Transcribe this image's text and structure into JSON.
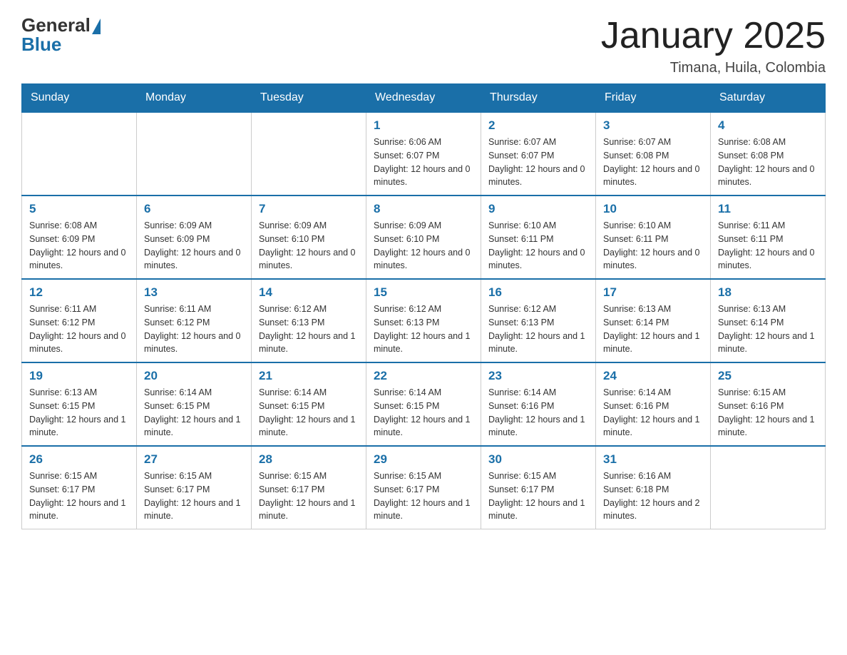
{
  "header": {
    "logo_general": "General",
    "logo_blue": "Blue",
    "title": "January 2025",
    "subtitle": "Timana, Huila, Colombia"
  },
  "weekdays": [
    "Sunday",
    "Monday",
    "Tuesday",
    "Wednesday",
    "Thursday",
    "Friday",
    "Saturday"
  ],
  "weeks": [
    [
      {
        "day": "",
        "sunrise": "",
        "sunset": "",
        "daylight": ""
      },
      {
        "day": "",
        "sunrise": "",
        "sunset": "",
        "daylight": ""
      },
      {
        "day": "",
        "sunrise": "",
        "sunset": "",
        "daylight": ""
      },
      {
        "day": "1",
        "sunrise": "Sunrise: 6:06 AM",
        "sunset": "Sunset: 6:07 PM",
        "daylight": "Daylight: 12 hours and 0 minutes."
      },
      {
        "day": "2",
        "sunrise": "Sunrise: 6:07 AM",
        "sunset": "Sunset: 6:07 PM",
        "daylight": "Daylight: 12 hours and 0 minutes."
      },
      {
        "day": "3",
        "sunrise": "Sunrise: 6:07 AM",
        "sunset": "Sunset: 6:08 PM",
        "daylight": "Daylight: 12 hours and 0 minutes."
      },
      {
        "day": "4",
        "sunrise": "Sunrise: 6:08 AM",
        "sunset": "Sunset: 6:08 PM",
        "daylight": "Daylight: 12 hours and 0 minutes."
      }
    ],
    [
      {
        "day": "5",
        "sunrise": "Sunrise: 6:08 AM",
        "sunset": "Sunset: 6:09 PM",
        "daylight": "Daylight: 12 hours and 0 minutes."
      },
      {
        "day": "6",
        "sunrise": "Sunrise: 6:09 AM",
        "sunset": "Sunset: 6:09 PM",
        "daylight": "Daylight: 12 hours and 0 minutes."
      },
      {
        "day": "7",
        "sunrise": "Sunrise: 6:09 AM",
        "sunset": "Sunset: 6:10 PM",
        "daylight": "Daylight: 12 hours and 0 minutes."
      },
      {
        "day": "8",
        "sunrise": "Sunrise: 6:09 AM",
        "sunset": "Sunset: 6:10 PM",
        "daylight": "Daylight: 12 hours and 0 minutes."
      },
      {
        "day": "9",
        "sunrise": "Sunrise: 6:10 AM",
        "sunset": "Sunset: 6:11 PM",
        "daylight": "Daylight: 12 hours and 0 minutes."
      },
      {
        "day": "10",
        "sunrise": "Sunrise: 6:10 AM",
        "sunset": "Sunset: 6:11 PM",
        "daylight": "Daylight: 12 hours and 0 minutes."
      },
      {
        "day": "11",
        "sunrise": "Sunrise: 6:11 AM",
        "sunset": "Sunset: 6:11 PM",
        "daylight": "Daylight: 12 hours and 0 minutes."
      }
    ],
    [
      {
        "day": "12",
        "sunrise": "Sunrise: 6:11 AM",
        "sunset": "Sunset: 6:12 PM",
        "daylight": "Daylight: 12 hours and 0 minutes."
      },
      {
        "day": "13",
        "sunrise": "Sunrise: 6:11 AM",
        "sunset": "Sunset: 6:12 PM",
        "daylight": "Daylight: 12 hours and 0 minutes."
      },
      {
        "day": "14",
        "sunrise": "Sunrise: 6:12 AM",
        "sunset": "Sunset: 6:13 PM",
        "daylight": "Daylight: 12 hours and 1 minute."
      },
      {
        "day": "15",
        "sunrise": "Sunrise: 6:12 AM",
        "sunset": "Sunset: 6:13 PM",
        "daylight": "Daylight: 12 hours and 1 minute."
      },
      {
        "day": "16",
        "sunrise": "Sunrise: 6:12 AM",
        "sunset": "Sunset: 6:13 PM",
        "daylight": "Daylight: 12 hours and 1 minute."
      },
      {
        "day": "17",
        "sunrise": "Sunrise: 6:13 AM",
        "sunset": "Sunset: 6:14 PM",
        "daylight": "Daylight: 12 hours and 1 minute."
      },
      {
        "day": "18",
        "sunrise": "Sunrise: 6:13 AM",
        "sunset": "Sunset: 6:14 PM",
        "daylight": "Daylight: 12 hours and 1 minute."
      }
    ],
    [
      {
        "day": "19",
        "sunrise": "Sunrise: 6:13 AM",
        "sunset": "Sunset: 6:15 PM",
        "daylight": "Daylight: 12 hours and 1 minute."
      },
      {
        "day": "20",
        "sunrise": "Sunrise: 6:14 AM",
        "sunset": "Sunset: 6:15 PM",
        "daylight": "Daylight: 12 hours and 1 minute."
      },
      {
        "day": "21",
        "sunrise": "Sunrise: 6:14 AM",
        "sunset": "Sunset: 6:15 PM",
        "daylight": "Daylight: 12 hours and 1 minute."
      },
      {
        "day": "22",
        "sunrise": "Sunrise: 6:14 AM",
        "sunset": "Sunset: 6:15 PM",
        "daylight": "Daylight: 12 hours and 1 minute."
      },
      {
        "day": "23",
        "sunrise": "Sunrise: 6:14 AM",
        "sunset": "Sunset: 6:16 PM",
        "daylight": "Daylight: 12 hours and 1 minute."
      },
      {
        "day": "24",
        "sunrise": "Sunrise: 6:14 AM",
        "sunset": "Sunset: 6:16 PM",
        "daylight": "Daylight: 12 hours and 1 minute."
      },
      {
        "day": "25",
        "sunrise": "Sunrise: 6:15 AM",
        "sunset": "Sunset: 6:16 PM",
        "daylight": "Daylight: 12 hours and 1 minute."
      }
    ],
    [
      {
        "day": "26",
        "sunrise": "Sunrise: 6:15 AM",
        "sunset": "Sunset: 6:17 PM",
        "daylight": "Daylight: 12 hours and 1 minute."
      },
      {
        "day": "27",
        "sunrise": "Sunrise: 6:15 AM",
        "sunset": "Sunset: 6:17 PM",
        "daylight": "Daylight: 12 hours and 1 minute."
      },
      {
        "day": "28",
        "sunrise": "Sunrise: 6:15 AM",
        "sunset": "Sunset: 6:17 PM",
        "daylight": "Daylight: 12 hours and 1 minute."
      },
      {
        "day": "29",
        "sunrise": "Sunrise: 6:15 AM",
        "sunset": "Sunset: 6:17 PM",
        "daylight": "Daylight: 12 hours and 1 minute."
      },
      {
        "day": "30",
        "sunrise": "Sunrise: 6:15 AM",
        "sunset": "Sunset: 6:17 PM",
        "daylight": "Daylight: 12 hours and 1 minute."
      },
      {
        "day": "31",
        "sunrise": "Sunrise: 6:16 AM",
        "sunset": "Sunset: 6:18 PM",
        "daylight": "Daylight: 12 hours and 2 minutes."
      },
      {
        "day": "",
        "sunrise": "",
        "sunset": "",
        "daylight": ""
      }
    ]
  ]
}
